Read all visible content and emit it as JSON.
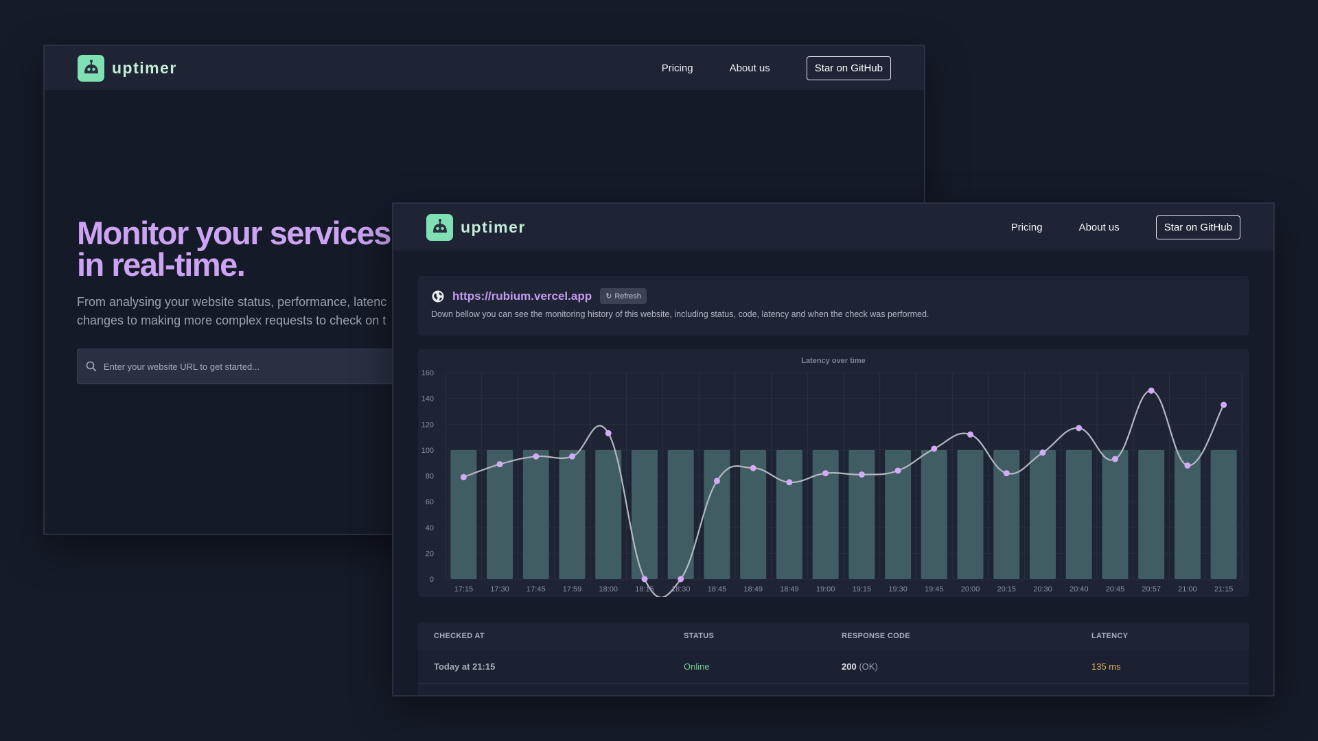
{
  "brand": {
    "name": "uptimer"
  },
  "nav": {
    "links": [
      "Pricing",
      "About us"
    ],
    "github_label": "Star on GitHub"
  },
  "hero": {
    "title_line1": "Monitor your services",
    "title_line2": "in real-time.",
    "desc_line1": "From analysing your website status, performance, latenc",
    "desc_line2": "changes to making more complex requests to check on t",
    "search_placeholder": "Enter your website URL to get started..."
  },
  "site": {
    "url": "https://rubium.vercel.app",
    "refresh_label": "Refresh",
    "description": "Down bellow you can see the monitoring history of this website, including status, code, latency and when the check was performed."
  },
  "chart_data": {
    "type": "bar",
    "title": "Latency over time",
    "xlabel": "",
    "ylabel": "",
    "ylim": [
      0,
      160
    ],
    "yticks": [
      0,
      20,
      40,
      60,
      80,
      100,
      120,
      140,
      160
    ],
    "categories": [
      "17:15",
      "17:30",
      "17:45",
      "17:59",
      "18:00",
      "18:15",
      "18:30",
      "18:45",
      "18:49",
      "18:49",
      "19:00",
      "19:15",
      "19:30",
      "19:45",
      "20:00",
      "20:15",
      "20:30",
      "20:40",
      "20:45",
      "20:57",
      "21:00",
      "21:15"
    ],
    "series": [
      {
        "kind": "bar",
        "values": [
          100,
          100,
          100,
          100,
          100,
          100,
          100,
          100,
          100,
          100,
          100,
          100,
          100,
          100,
          100,
          100,
          100,
          100,
          100,
          100,
          100,
          100
        ]
      },
      {
        "kind": "line",
        "values": [
          79,
          89,
          95,
          95,
          113,
          0,
          0,
          76,
          86,
          75,
          82,
          81,
          84,
          101,
          112,
          82,
          98,
          117,
          93,
          146,
          88,
          135
        ]
      }
    ],
    "colors": {
      "bar": "#3f5d63",
      "line": "#b5b8c2",
      "point": "#d4aaf7"
    },
    "grid": true
  },
  "table": {
    "headers": [
      "CHECKED AT",
      "STATUS",
      "RESPONSE CODE",
      "LATENCY"
    ],
    "rows": [
      {
        "checked": "Today at 21:15",
        "status": "Online",
        "code": "200",
        "code_text": "(OK)",
        "latency": "135 ms"
      }
    ]
  }
}
